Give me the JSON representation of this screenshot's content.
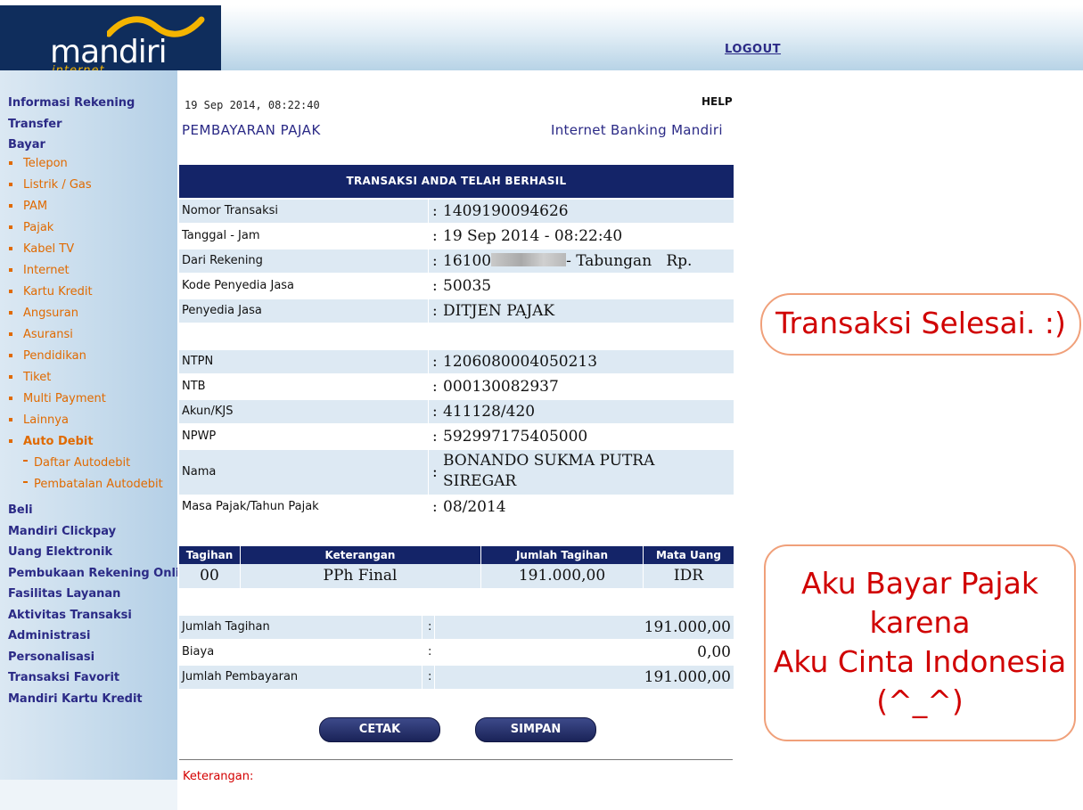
{
  "header": {
    "logo_text": "mandiri",
    "logo_sub": "internet",
    "logout": "LOGOUT"
  },
  "sidebar": {
    "informasi": "Informasi Rekening",
    "transfer": "Transfer",
    "bayar": "Bayar",
    "bayar_items": [
      "Telepon",
      "Listrik / Gas",
      "PAM",
      "Pajak",
      "Kabel TV",
      "Internet",
      "Kartu Kredit",
      "Angsuran",
      "Asuransi",
      "Pendidikan",
      "Tiket",
      "Multi Payment",
      "Lainnya",
      "Auto Debit"
    ],
    "autodebit_items": [
      "Daftar Autodebit",
      "Pembatalan Autodebit"
    ],
    "main_items": [
      "Beli",
      "Mandiri Clickpay",
      "Uang Elektronik",
      "Pembukaan Rekening Online",
      "Fasilitas Layanan",
      "Aktivitas Transaksi",
      "Administrasi",
      "Personalisasi",
      "Transaksi Favorit",
      "Mandiri Kartu Kredit"
    ]
  },
  "content": {
    "datetime": "19 Sep 2014, 08:22:40",
    "help": "HELP",
    "title": "PEMBAYARAN PAJAK",
    "brand": "Internet Banking Mandiri",
    "success": "TRANSAKSI ANDA TELAH BERHASIL",
    "rows": [
      {
        "label": "Nomor Transaksi",
        "value": "1409190094626"
      },
      {
        "label": "Tanggal - Jam",
        "value": "19 Sep 2014 - 08:22:40"
      },
      {
        "label": "Dari Rekening",
        "value_prefix": "16100",
        "value_suffix": "- Tabungan   Rp."
      },
      {
        "label": "Kode Penyedia Jasa",
        "value": "50035"
      },
      {
        "label": "Penyedia Jasa",
        "value": "DITJEN PAJAK"
      },
      {
        "label": "",
        "value": ""
      },
      {
        "label": "NTPN",
        "value": "1206080004050213"
      },
      {
        "label": "NTB",
        "value": "000130082937"
      },
      {
        "label": "Akun/KJS",
        "value": "411128/420"
      },
      {
        "label": "NPWP",
        "value": "592997175405000"
      }
    ],
    "nama_label": "Nama",
    "nama_value": "BONANDO SUKMA PUTRA SIREGAR",
    "masa_label": "Masa Pajak/Tahun Pajak",
    "masa_value": "08/2014",
    "colon": ":",
    "bill": {
      "headers": [
        "Tagihan",
        "Keterangan",
        "Jumlah Tagihan",
        "Mata Uang"
      ],
      "row": [
        "00",
        "PPh Final",
        "191.000,00",
        "IDR"
      ]
    },
    "summary": [
      {
        "label": "Jumlah Tagihan",
        "value": "191.000,00"
      },
      {
        "label": "Biaya",
        "value": "0,00"
      },
      {
        "label": "Jumlah Pembayaran",
        "value": "191.000,00"
      }
    ],
    "buttons": {
      "cetak": "CETAK",
      "simpan": "SIMPAN"
    },
    "keterangan": "Keterangan:"
  },
  "annotations": {
    "bubble1": "Transaksi Selesai. :)",
    "bubble2": [
      "Aku Bayar Pajak",
      "karena",
      "Aku Cinta Indonesia",
      "(^_^)"
    ]
  },
  "colors": {
    "navy": "#142468",
    "nav_text": "#2b2a86",
    "orange": "#e06a00",
    "red": "#d00000",
    "row_alt": "#dde9f3"
  }
}
